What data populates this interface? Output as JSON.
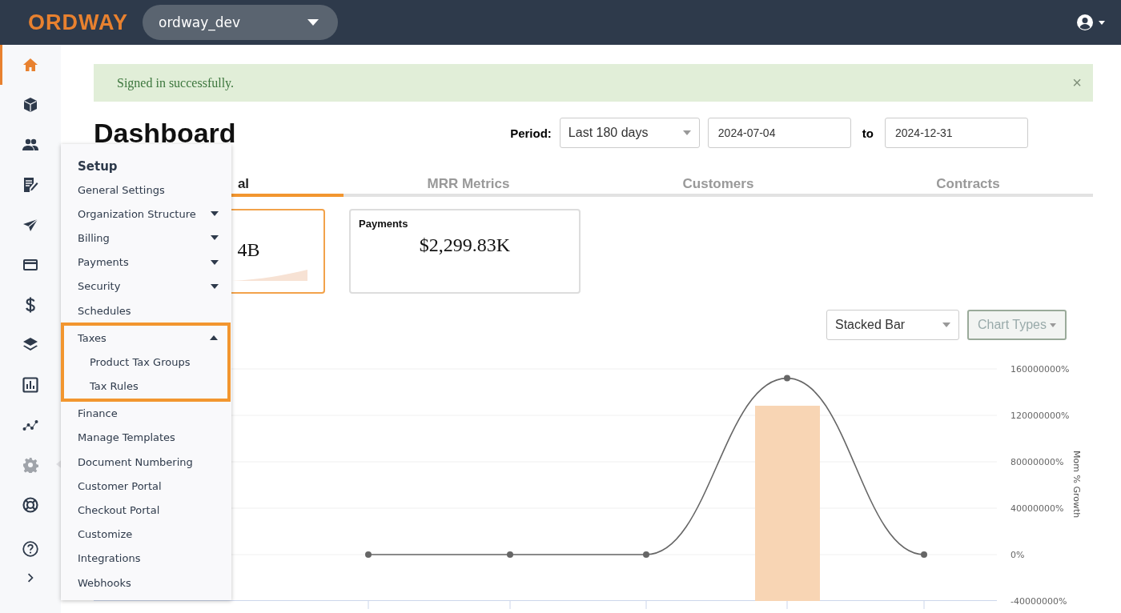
{
  "header": {
    "logo": "ORDWAY",
    "org_select": {
      "value": "ordway_dev"
    }
  },
  "sidebar": {
    "items": [
      {
        "selected": true
      },
      {
        "selected": false
      },
      {
        "selected": false
      },
      {
        "selected": false
      },
      {
        "selected": false
      },
      {
        "selected": false
      },
      {
        "selected": false
      },
      {
        "selected": false
      },
      {
        "selected": false
      },
      {
        "selected": false
      },
      {
        "selected": false,
        "expanded": true
      },
      {
        "selected": false
      },
      {
        "selected": false
      },
      {
        "selected": false
      }
    ]
  },
  "alert": {
    "message": "Signed in successfully.",
    "close": "×"
  },
  "page": {
    "title": "Dashboard",
    "period_label": "Period:",
    "period_select": {
      "value": "Last 180 days"
    },
    "start_date": {
      "value": "2024-07-04"
    },
    "to_label": "to",
    "end_date": {
      "value": "2024-12-31"
    }
  },
  "tabs": [
    {
      "label": "al",
      "selected": true
    },
    {
      "label": "MRR Metrics",
      "selected": false
    },
    {
      "label": "Customers",
      "selected": false
    },
    {
      "label": "Contracts",
      "selected": false
    }
  ],
  "cards": [
    {
      "value": "4B",
      "selected": true
    },
    {
      "title": "Payments",
      "value": "$2,299.83K",
      "selected": false
    }
  ],
  "chart_controls": {
    "type_select": {
      "value": "Stacked Bar"
    },
    "chart_types_button": "Chart Types"
  },
  "chart": {
    "chart_data": {
      "type": "line",
      "ylabel": "Mom % Growth",
      "ylim": [
        -40000000,
        160000000
      ],
      "yticks": [
        {
          "value": -40000000,
          "label": "-40000000%"
        },
        {
          "value": 0,
          "label": "0%"
        },
        {
          "value": 40000000,
          "label": "40000000%"
        },
        {
          "value": 80000000,
          "label": "80000000%"
        },
        {
          "value": 120000000,
          "label": "120000000%"
        },
        {
          "value": 160000000,
          "label": "160000000%"
        }
      ],
      "grid": true,
      "series": [
        {
          "color": "#666666",
          "marker": true,
          "values": [
            0,
            0,
            0,
            152000000,
            0
          ]
        }
      ]
    }
  },
  "setup_menu": {
    "title": "Setup",
    "items": [
      {
        "label": "General Settings"
      },
      {
        "label": "Organization Structure",
        "expanded": false
      },
      {
        "label": "Billing",
        "expanded": false
      },
      {
        "label": "Payments",
        "expanded": false
      },
      {
        "label": "Security",
        "expanded": false
      },
      {
        "label": "Schedules"
      },
      {
        "label": "Taxes",
        "expanded": true,
        "highlighted": true,
        "children": [
          {
            "label": "Product Tax Groups"
          },
          {
            "label": "Tax Rules"
          }
        ]
      },
      {
        "label": "Finance"
      },
      {
        "label": "Manage Templates"
      },
      {
        "label": "Document Numbering"
      },
      {
        "label": "Customer Portal"
      },
      {
        "label": "Checkout Portal"
      },
      {
        "label": "Customize"
      },
      {
        "label": "Integrations"
      },
      {
        "label": "Webhooks"
      }
    ]
  }
}
